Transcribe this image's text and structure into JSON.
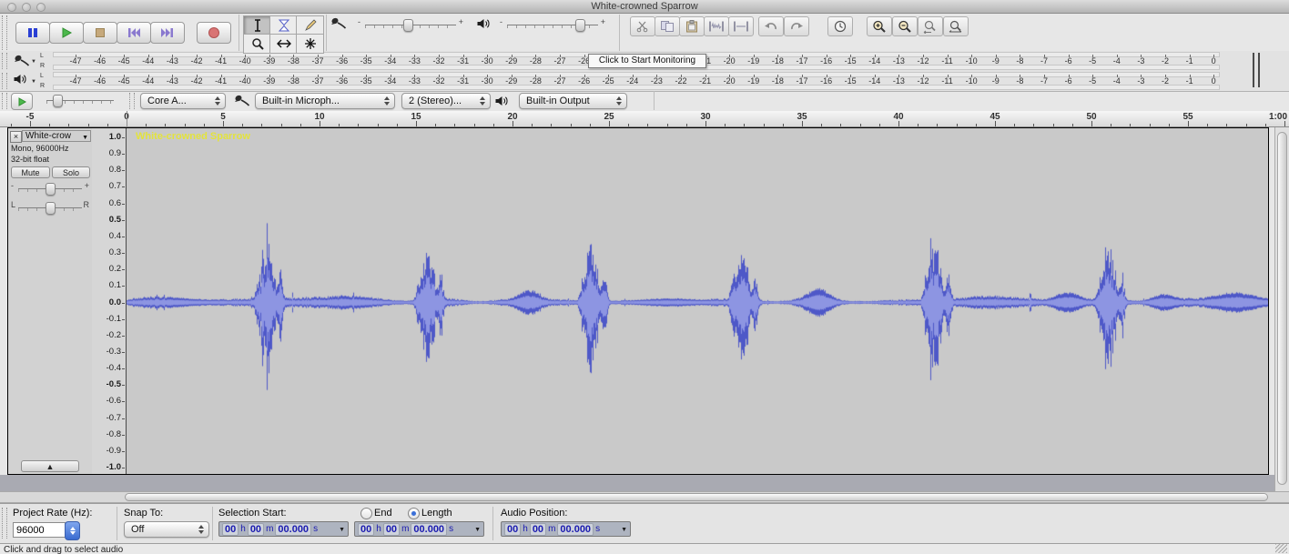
{
  "icons": {
    "dropdown_arrow": "▼",
    "close_x": "×",
    "collapse_up": "▲",
    "meter_arrow": "▼"
  },
  "titlebar": {
    "title": "White-crowned Sparrow"
  },
  "transport": {
    "buttons": [
      "pause",
      "play",
      "stop",
      "skip-to-start",
      "skip-to-end",
      "record"
    ]
  },
  "tools": {
    "selected": "selection",
    "items": [
      "selection",
      "envelope",
      "draw",
      "zoom",
      "time-shift",
      "multi-tool"
    ]
  },
  "mixer": {
    "minus": "-",
    "plus": "+"
  },
  "edit": {
    "items": [
      "cut",
      "copy",
      "paste",
      "trim",
      "silence",
      "undo",
      "redo",
      "sync-lock",
      "zoom-in",
      "zoom-out",
      "fit-selection",
      "fit-project"
    ]
  },
  "meters": {
    "record_channels": [
      "L",
      "R"
    ],
    "play_channels": [
      "L",
      "R"
    ],
    "scale": [
      "-47",
      "-46",
      "-45",
      "-44",
      "-43",
      "-42",
      "-41",
      "-40",
      "-39",
      "-38",
      "-37",
      "-36",
      "-35",
      "-34",
      "-33",
      "-32",
      "-31",
      "-30",
      "-29",
      "-28",
      "-27",
      "-26",
      "-25",
      "-24",
      "-23",
      "-22",
      "-21",
      "-20",
      "-19",
      "-18",
      "-17",
      "-16",
      "-15",
      "-14",
      "-13",
      "-12",
      "-11",
      "-10",
      "-9",
      "-8",
      "-7",
      "-6",
      "-5",
      "-4",
      "-3",
      "-2",
      "-1",
      "0"
    ],
    "tooltip": "Click to Start Monitoring"
  },
  "device": {
    "host": "Core A...",
    "input": "Built-in Microph...",
    "channels": "2 (Stereo)...",
    "output": "Built-in Output"
  },
  "timeline": {
    "major": [
      {
        "t": -5,
        "label": "-5"
      },
      {
        "t": 0,
        "label": "0"
      },
      {
        "t": 5,
        "label": "5"
      },
      {
        "t": 10,
        "label": "10"
      },
      {
        "t": 15,
        "label": "15"
      },
      {
        "t": 20,
        "label": "20"
      },
      {
        "t": 25,
        "label": "25"
      },
      {
        "t": 30,
        "label": "30"
      },
      {
        "t": 35,
        "label": "35"
      },
      {
        "t": 40,
        "label": "40"
      },
      {
        "t": 45,
        "label": "45"
      },
      {
        "t": 50,
        "label": "50"
      },
      {
        "t": 55,
        "label": "55"
      },
      {
        "t": 60,
        "label": "1:00"
      }
    ]
  },
  "track": {
    "name": "White-crow",
    "format": "Mono, 96000Hz",
    "depth": "32-bit float",
    "mute": "Mute",
    "solo": "Solo",
    "gain_minus": "-",
    "gain_plus": "+",
    "pan_left": "L",
    "pan_right": "R",
    "overlay_name": "White-crowned Sparrow"
  },
  "amp_ruler": {
    "labels": [
      "1.0",
      "0.9",
      "0.8",
      "0.7",
      "0.6",
      "0.5",
      "0.4",
      "0.3",
      "0.2",
      "0.1",
      "0.0",
      "-0.1",
      "-0.2",
      "-0.3",
      "-0.4",
      "-0.5",
      "-0.6",
      "-0.7",
      "-0.8",
      "-0.9",
      "-1.0"
    ],
    "bold": [
      "1.0",
      "0.5",
      "0.0",
      "-0.5",
      "-1.0"
    ]
  },
  "waveform": {
    "type": "waveform",
    "bg": "#c9c9c9",
    "peak": "#4e58c8",
    "rms": "#8d95e2",
    "noise": 0.018,
    "pps": 21.2,
    "bursts": [
      {
        "t": 7.3,
        "a": 0.34
      },
      {
        "t": 15.6,
        "a": 0.31
      },
      {
        "t": 24.1,
        "a": 0.34
      },
      {
        "t": 31.9,
        "a": 0.31
      },
      {
        "t": 41.9,
        "a": 0.33
      },
      {
        "t": 50.9,
        "a": 0.32
      }
    ],
    "humps": [
      {
        "t": 20.8,
        "a": 0.055,
        "w": 0.45
      },
      {
        "t": 35.8,
        "a": 0.07,
        "w": 0.5
      },
      {
        "t": 48.7,
        "a": 0.06,
        "w": 0.55
      },
      {
        "t": 53.6,
        "a": 0.04,
        "w": 0.5
      },
      {
        "t": 57.5,
        "a": 0.045,
        "w": 0.9
      },
      {
        "t": 2.5,
        "a": 0.02,
        "w": 1.2
      },
      {
        "t": 11.5,
        "a": 0.018,
        "w": 1.5
      },
      {
        "t": 28.0,
        "a": 0.018,
        "w": 1.2
      },
      {
        "t": 44.5,
        "a": 0.018,
        "w": 1.0
      }
    ]
  },
  "selection_bar": {
    "rate_label": "Project Rate (Hz):",
    "rate_value": "96000",
    "snap_label": "Snap To:",
    "snap_value": "Off",
    "sel_start_label": "Selection Start:",
    "end_label": "End",
    "length_label": "Length",
    "selected_radio": "Length",
    "audio_pos_label": "Audio Position:",
    "sel_start_value": "00 h 00 m 00.000 s",
    "sel_len_value": "00 h 00 m 00.000 s",
    "audio_pos_value": "00 h 00 m 00.000 s"
  },
  "status": {
    "message": "Click and drag to select audio"
  }
}
